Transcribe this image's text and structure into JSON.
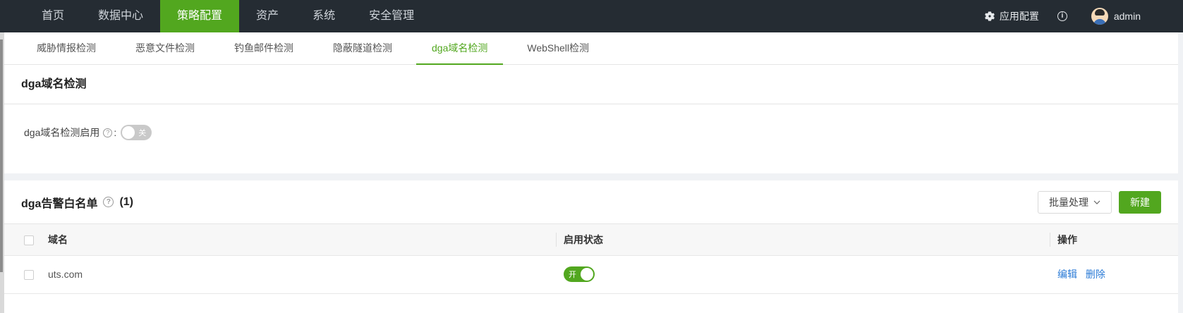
{
  "nav": {
    "items": [
      "首页",
      "数据中心",
      "策略配置",
      "资产",
      "系统",
      "安全管理"
    ],
    "active_index": 2,
    "app_config_label": "应用配置",
    "username": "admin"
  },
  "tabs": {
    "items": [
      "威胁情报检测",
      "恶意文件检测",
      "钓鱼邮件检测",
      "隐蔽隧道检测",
      "dga域名检测",
      "WebShell检测"
    ],
    "active_index": 4
  },
  "section": {
    "title": "dga域名检测",
    "enable_label": "dga域名检测启用",
    "enable_colon": ":",
    "enable_switch_text": "关",
    "enabled": false
  },
  "whitelist": {
    "title": "dga告警白名单",
    "count": "(1)",
    "batch_label": "批量处理",
    "new_label": "新建",
    "columns": [
      "域名",
      "启用状态",
      "操作"
    ],
    "rows": [
      {
        "domain": "uts.com",
        "status_text": "开",
        "enabled": true,
        "edit": "编辑",
        "delete": "删除"
      }
    ]
  },
  "colors": {
    "accent": "#52a71f",
    "nav_bg": "#252c33",
    "link": "#2b7bd6"
  }
}
